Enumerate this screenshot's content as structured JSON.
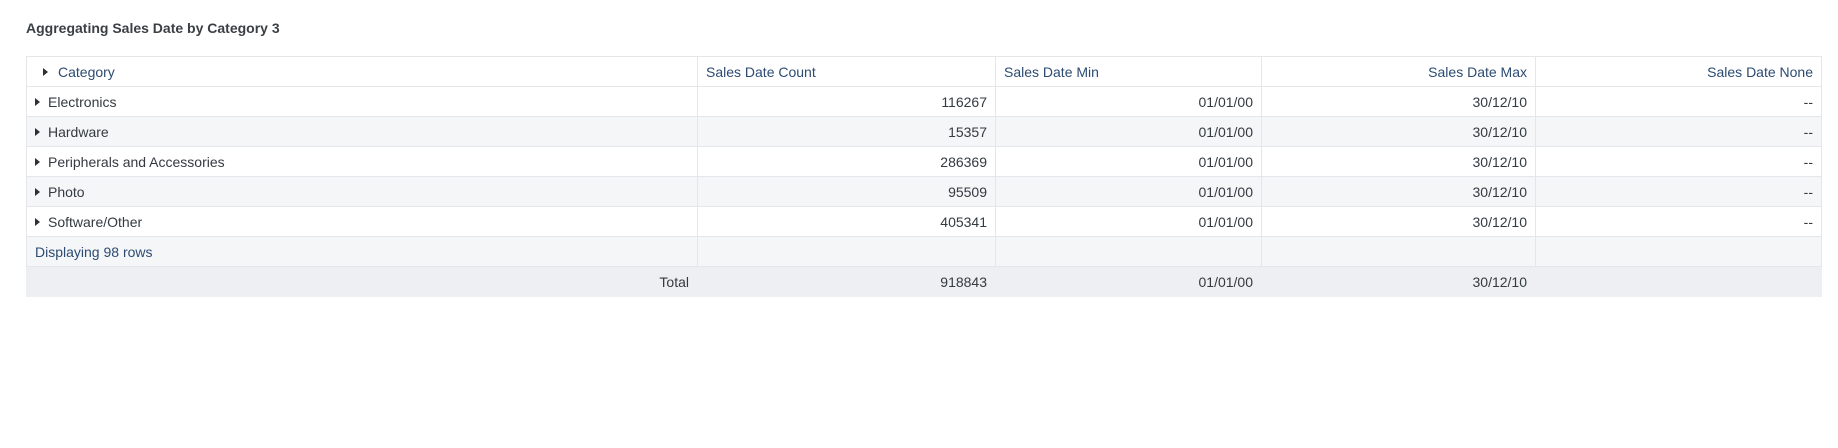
{
  "title": "Aggregating Sales Date by Category 3",
  "columns": {
    "category": "Category",
    "count": "Sales Date Count",
    "min": "Sales Date Min",
    "max": "Sales Date Max",
    "none": "Sales Date None"
  },
  "rows": [
    {
      "category": "Electronics",
      "count": "116267",
      "min": "01/01/00",
      "max": "30/12/10",
      "none": "--"
    },
    {
      "category": "Hardware",
      "count": "15357",
      "min": "01/01/00",
      "max": "30/12/10",
      "none": "--"
    },
    {
      "category": "Peripherals and Accessories",
      "count": "286369",
      "min": "01/01/00",
      "max": "30/12/10",
      "none": "--"
    },
    {
      "category": "Photo",
      "count": "95509",
      "min": "01/01/00",
      "max": "30/12/10",
      "none": "--"
    },
    {
      "category": "Software/Other",
      "count": "405341",
      "min": "01/01/00",
      "max": "30/12/10",
      "none": "--"
    }
  ],
  "footer": {
    "displaying": "Displaying 98 rows"
  },
  "total": {
    "label": "Total",
    "count": "918843",
    "min": "01/01/00",
    "max": "30/12/10",
    "none": ""
  }
}
